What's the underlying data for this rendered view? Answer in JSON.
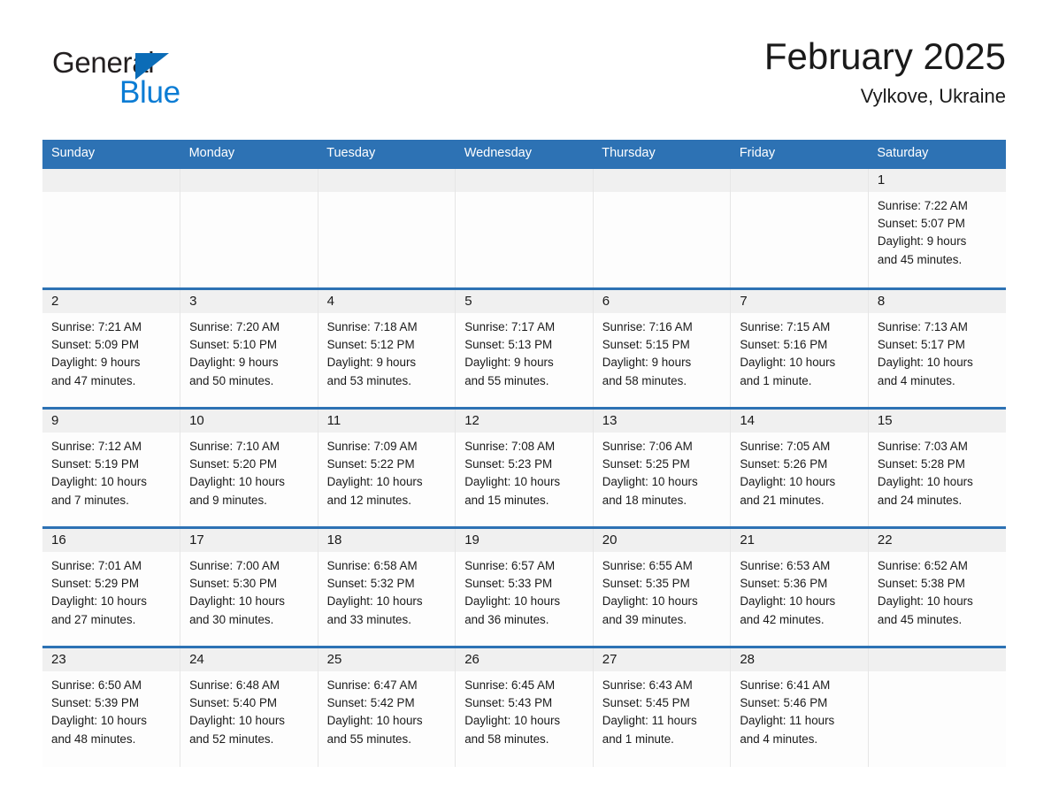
{
  "brand": {
    "name_part1": "General",
    "name_part2": "Blue",
    "triangle_color": "#0b6cb7",
    "blue_color": "#0b7cd4"
  },
  "header": {
    "month_title": "February 2025",
    "location": "Vylkove, Ukraine"
  },
  "colors": {
    "header_blue": "#2d72b4",
    "daynum_band": "#f0f0f0",
    "cell_background": "#fdfdfd",
    "text": "#1a1a1a"
  },
  "weekdays": [
    "Sunday",
    "Monday",
    "Tuesday",
    "Wednesday",
    "Thursday",
    "Friday",
    "Saturday"
  ],
  "weeks": [
    [
      {
        "day": "",
        "lines": []
      },
      {
        "day": "",
        "lines": []
      },
      {
        "day": "",
        "lines": []
      },
      {
        "day": "",
        "lines": []
      },
      {
        "day": "",
        "lines": []
      },
      {
        "day": "",
        "lines": []
      },
      {
        "day": "1",
        "lines": [
          "Sunrise: 7:22 AM",
          "Sunset: 5:07 PM",
          "Daylight: 9 hours",
          "and 45 minutes."
        ]
      }
    ],
    [
      {
        "day": "2",
        "lines": [
          "Sunrise: 7:21 AM",
          "Sunset: 5:09 PM",
          "Daylight: 9 hours",
          "and 47 minutes."
        ]
      },
      {
        "day": "3",
        "lines": [
          "Sunrise: 7:20 AM",
          "Sunset: 5:10 PM",
          "Daylight: 9 hours",
          "and 50 minutes."
        ]
      },
      {
        "day": "4",
        "lines": [
          "Sunrise: 7:18 AM",
          "Sunset: 5:12 PM",
          "Daylight: 9 hours",
          "and 53 minutes."
        ]
      },
      {
        "day": "5",
        "lines": [
          "Sunrise: 7:17 AM",
          "Sunset: 5:13 PM",
          "Daylight: 9 hours",
          "and 55 minutes."
        ]
      },
      {
        "day": "6",
        "lines": [
          "Sunrise: 7:16 AM",
          "Sunset: 5:15 PM",
          "Daylight: 9 hours",
          "and 58 minutes."
        ]
      },
      {
        "day": "7",
        "lines": [
          "Sunrise: 7:15 AM",
          "Sunset: 5:16 PM",
          "Daylight: 10 hours",
          "and 1 minute."
        ]
      },
      {
        "day": "8",
        "lines": [
          "Sunrise: 7:13 AM",
          "Sunset: 5:17 PM",
          "Daylight: 10 hours",
          "and 4 minutes."
        ]
      }
    ],
    [
      {
        "day": "9",
        "lines": [
          "Sunrise: 7:12 AM",
          "Sunset: 5:19 PM",
          "Daylight: 10 hours",
          "and 7 minutes."
        ]
      },
      {
        "day": "10",
        "lines": [
          "Sunrise: 7:10 AM",
          "Sunset: 5:20 PM",
          "Daylight: 10 hours",
          "and 9 minutes."
        ]
      },
      {
        "day": "11",
        "lines": [
          "Sunrise: 7:09 AM",
          "Sunset: 5:22 PM",
          "Daylight: 10 hours",
          "and 12 minutes."
        ]
      },
      {
        "day": "12",
        "lines": [
          "Sunrise: 7:08 AM",
          "Sunset: 5:23 PM",
          "Daylight: 10 hours",
          "and 15 minutes."
        ]
      },
      {
        "day": "13",
        "lines": [
          "Sunrise: 7:06 AM",
          "Sunset: 5:25 PM",
          "Daylight: 10 hours",
          "and 18 minutes."
        ]
      },
      {
        "day": "14",
        "lines": [
          "Sunrise: 7:05 AM",
          "Sunset: 5:26 PM",
          "Daylight: 10 hours",
          "and 21 minutes."
        ]
      },
      {
        "day": "15",
        "lines": [
          "Sunrise: 7:03 AM",
          "Sunset: 5:28 PM",
          "Daylight: 10 hours",
          "and 24 minutes."
        ]
      }
    ],
    [
      {
        "day": "16",
        "lines": [
          "Sunrise: 7:01 AM",
          "Sunset: 5:29 PM",
          "Daylight: 10 hours",
          "and 27 minutes."
        ]
      },
      {
        "day": "17",
        "lines": [
          "Sunrise: 7:00 AM",
          "Sunset: 5:30 PM",
          "Daylight: 10 hours",
          "and 30 minutes."
        ]
      },
      {
        "day": "18",
        "lines": [
          "Sunrise: 6:58 AM",
          "Sunset: 5:32 PM",
          "Daylight: 10 hours",
          "and 33 minutes."
        ]
      },
      {
        "day": "19",
        "lines": [
          "Sunrise: 6:57 AM",
          "Sunset: 5:33 PM",
          "Daylight: 10 hours",
          "and 36 minutes."
        ]
      },
      {
        "day": "20",
        "lines": [
          "Sunrise: 6:55 AM",
          "Sunset: 5:35 PM",
          "Daylight: 10 hours",
          "and 39 minutes."
        ]
      },
      {
        "day": "21",
        "lines": [
          "Sunrise: 6:53 AM",
          "Sunset: 5:36 PM",
          "Daylight: 10 hours",
          "and 42 minutes."
        ]
      },
      {
        "day": "22",
        "lines": [
          "Sunrise: 6:52 AM",
          "Sunset: 5:38 PM",
          "Daylight: 10 hours",
          "and 45 minutes."
        ]
      }
    ],
    [
      {
        "day": "23",
        "lines": [
          "Sunrise: 6:50 AM",
          "Sunset: 5:39 PM",
          "Daylight: 10 hours",
          "and 48 minutes."
        ]
      },
      {
        "day": "24",
        "lines": [
          "Sunrise: 6:48 AM",
          "Sunset: 5:40 PM",
          "Daylight: 10 hours",
          "and 52 minutes."
        ]
      },
      {
        "day": "25",
        "lines": [
          "Sunrise: 6:47 AM",
          "Sunset: 5:42 PM",
          "Daylight: 10 hours",
          "and 55 minutes."
        ]
      },
      {
        "day": "26",
        "lines": [
          "Sunrise: 6:45 AM",
          "Sunset: 5:43 PM",
          "Daylight: 10 hours",
          "and 58 minutes."
        ]
      },
      {
        "day": "27",
        "lines": [
          "Sunrise: 6:43 AM",
          "Sunset: 5:45 PM",
          "Daylight: 11 hours",
          "and 1 minute."
        ]
      },
      {
        "day": "28",
        "lines": [
          "Sunrise: 6:41 AM",
          "Sunset: 5:46 PM",
          "Daylight: 11 hours",
          "and 4 minutes."
        ]
      },
      {
        "day": "",
        "lines": []
      }
    ]
  ]
}
